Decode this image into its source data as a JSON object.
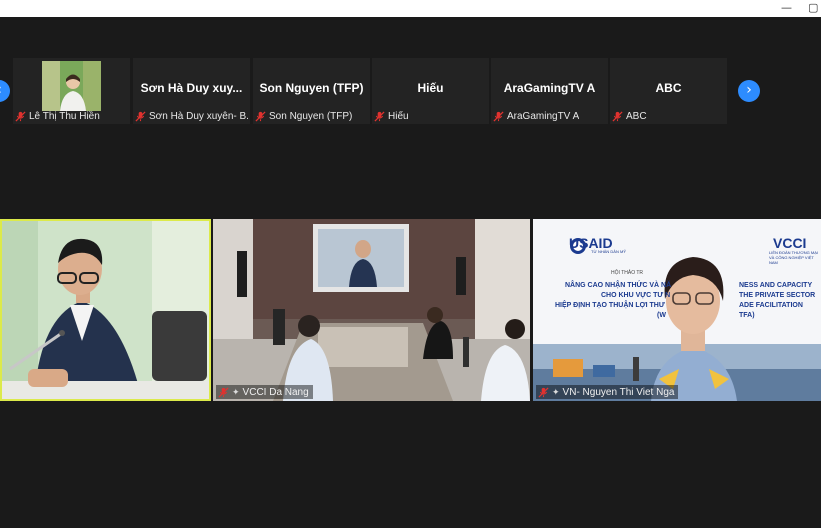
{
  "window": {
    "minimize_glyph": "—",
    "maximize_glyph": "▢"
  },
  "strip": {
    "prev_glyph": "‹",
    "next_glyph": "›",
    "participants": [
      {
        "name": "",
        "label": "Lê Thị Thu Hiền",
        "has_video": true
      },
      {
        "name": "Sơn Hà Duy xuy...",
        "label": "Sơn Hà Duy xuyên- B...",
        "has_video": false
      },
      {
        "name": "Son Nguyen (TFP)",
        "label": "Son Nguyen (TFP)",
        "has_video": false
      },
      {
        "name": "Hiếu",
        "label": "Hiếu",
        "has_video": false
      },
      {
        "name": "AraGamingTV A",
        "label": "AraGamingTV A",
        "has_video": false
      },
      {
        "name": "ABC",
        "label": "ABC",
        "has_video": false
      }
    ]
  },
  "tiles": [
    {
      "label": "",
      "active_speaker": true
    },
    {
      "label": "VCCI Da Nang"
    },
    {
      "label": "VN- Nguyen Thi Viet Nga"
    }
  ],
  "banner": {
    "logo_left": "USAID",
    "logo_left_sub": "TỪ NHÂN DÂN MỸ",
    "logo_right": "VCCI",
    "logo_right_sub": "LIÊN ĐOÀN THƯƠNG MẠI VÀ CÔNG NGHIỆP VIỆT NAM",
    "event_label": "HỘI THẢO TR",
    "line1_left": "NÂNG CAO NHẬN THỨC VÀ NĂ",
    "line1_right": "NESS AND CAPACITY",
    "line2_left": "CHO KHU VỰC TƯ N",
    "line2_right": "THE PRIVATE SECTOR",
    "line3_left": "HIỆP ĐỊNH TẠO THUẬN LỢI THƯ",
    "line3_right": "ADE FACILITATION",
    "line4_left": "(W",
    "line4_right": "TFA)"
  },
  "colors": {
    "accent": "#2d8cff",
    "active_speaker_border": "#dcea4a",
    "mic_off": "#e0322f"
  }
}
